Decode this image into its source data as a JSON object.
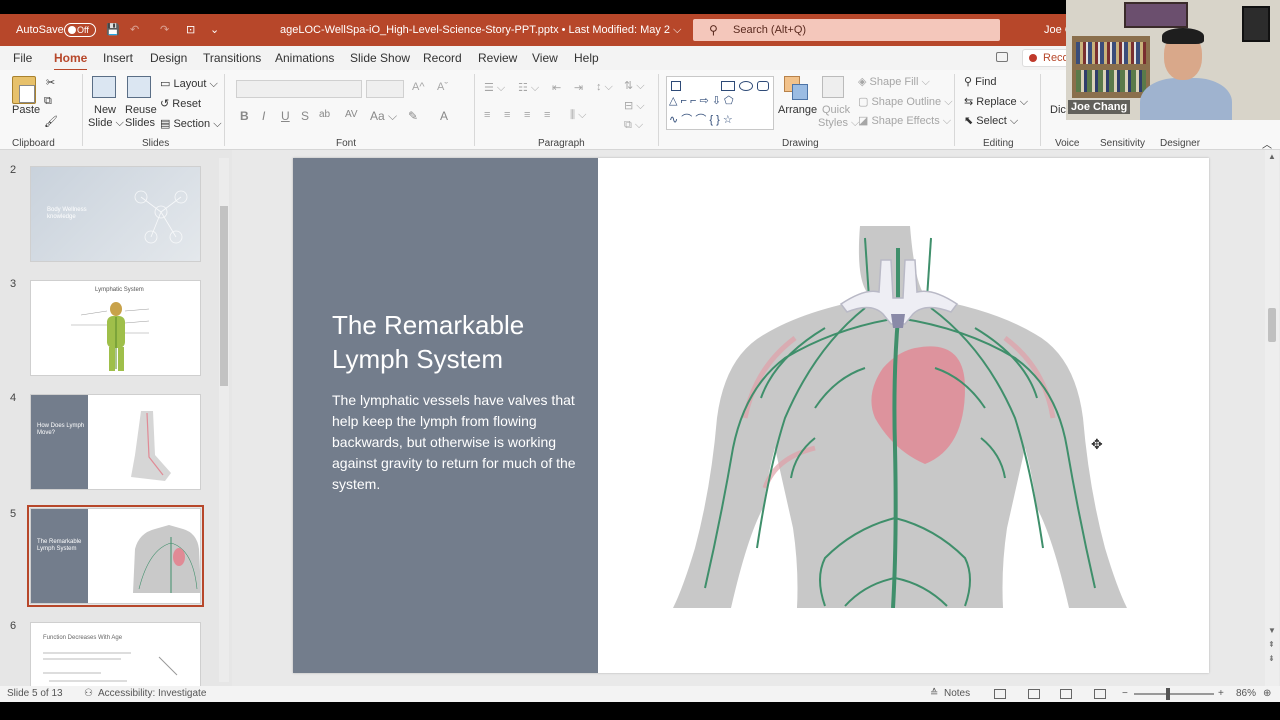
{
  "titlebar": {
    "autosave_label": "AutoSave",
    "autosave_state": "Off",
    "document_title": "ageLOC-WellSpa-iO_High-Level-Science-Story-PPT.pptx • Last Modified: May 2 ⌵",
    "search_placeholder": "Search (Alt+Q)",
    "user_name": "Joe C"
  },
  "menu": {
    "tabs": [
      "File",
      "Home",
      "Insert",
      "Design",
      "Transitions",
      "Animations",
      "Slide Show",
      "Record",
      "Review",
      "View",
      "Help"
    ],
    "active_tab": "Home",
    "record_label": "Reco"
  },
  "ribbon": {
    "clipboard": {
      "paste": "Paste",
      "label": "Clipboard"
    },
    "slides": {
      "new_slide": "New",
      "new_slide2": "Slide ⌵",
      "reuse": "Reuse",
      "reuse2": "Slides",
      "layout": "Layout ⌵",
      "reset": "Reset",
      "section": "Section ⌵",
      "label": "Slides"
    },
    "font": {
      "label": "Font",
      "bold": "B",
      "italic": "I",
      "underline": "U",
      "strike": "S",
      "shadow": "ab",
      "case": "Aa ⌵"
    },
    "paragraph": {
      "label": "Paragraph"
    },
    "drawing": {
      "arrange": "Arrange",
      "quick_styles": "Quick",
      "quick_styles2": "Styles ⌵",
      "shape_fill": "Shape Fill ⌵",
      "shape_outline": "Shape Outline ⌵",
      "shape_effects": "Shape Effects ⌵",
      "label": "Drawing"
    },
    "editing": {
      "find": "Find",
      "replace": "Replace ⌵",
      "select": "Select ⌵",
      "label": "Editing"
    },
    "voice": {
      "dictate": "Dict",
      "label": "Voice"
    },
    "sensitivity": {
      "label": "Sensitivity"
    },
    "designer": {
      "label": "Designer"
    }
  },
  "webcam": {
    "participant": "Joe Chang"
  },
  "thumbnails": [
    {
      "number": "2",
      "text": "Body Wellness\nknowledge"
    },
    {
      "number": "3",
      "text": "Lymphatic System"
    },
    {
      "number": "4",
      "text": "How Does Lymph Move?"
    },
    {
      "number": "5",
      "text": "The Remarkable Lymph System"
    },
    {
      "number": "6",
      "text": "Function Decreases With Age"
    }
  ],
  "slide": {
    "title": "The Remarkable Lymph System",
    "body": "The lymphatic vessels have valves that help keep the lymph from flowing backwards, but otherwise is working against gravity to return for much of the system."
  },
  "status": {
    "slide_counter": "Slide 5 of 13",
    "accessibility": "Accessibility: Investigate",
    "notes": "Notes",
    "zoom": "86%"
  },
  "colors": {
    "accent": "#b7472a",
    "slide_panel": "#737d8c",
    "body_figure": "#c4c4c4",
    "lymph_vessels": "#3f8f6b",
    "heart": "#e08a95"
  }
}
